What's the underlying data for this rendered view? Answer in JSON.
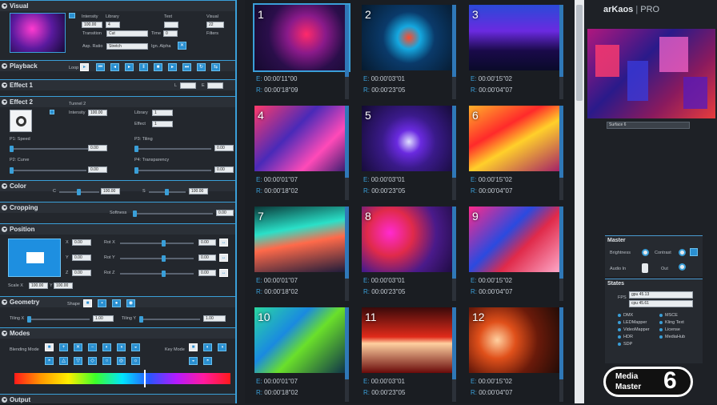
{
  "panel": {
    "visual": {
      "title": "Visual",
      "intensity_label": "Intensity",
      "intensity_value": "100.00",
      "library_label": "Library",
      "library_value": "4",
      "transition_label": "Transition",
      "transition_value": "Cut",
      "time_label": "Time",
      "time_value": "0",
      "aspect_label": "Asp. Ratio",
      "aspect_value": "Stretch",
      "ign_alpha_label": "Ign. Alpha",
      "text_label": "Text",
      "visual_label": "Visual",
      "visual_value": "22",
      "filters_label": "Filters"
    },
    "playback": {
      "title": "Playback",
      "loop_label": "Loop"
    },
    "effect1": {
      "title": "Effect 1",
      "l_label": "L",
      "e_label": "E"
    },
    "effect2": {
      "title": "Effect 2",
      "tunnel_label": "Tunnel 2",
      "intensity_label": "Intensity",
      "intensity_value": "100.00",
      "library_label": "Library",
      "library_value": "1",
      "effect_label": "Effect",
      "effect_value": "1",
      "p1": "P1: Speed",
      "p2": "P2: Curve",
      "p3": "P3: Tiling",
      "p4": "P4: Transparency",
      "v": "0.00"
    },
    "color": {
      "title": "Color",
      "c_label": "C",
      "c_value": "100.00",
      "s_label": "S",
      "s_value": "100.00"
    },
    "cropping": {
      "title": "Cropping",
      "softness_label": "Softness",
      "softness_value": "0.00"
    },
    "position": {
      "title": "Position",
      "x": "X",
      "y": "Y",
      "z": "Z",
      "rotx": "Rot X",
      "roty": "Rot Y",
      "rotz": "Rot Z",
      "v": "0.00",
      "scale_x_label": "Scale X",
      "scale_x": "100.00",
      "scale_y_label": "Y",
      "scale_y": "100.00"
    },
    "geometry": {
      "title": "Geometry",
      "shape_label": "Shape",
      "tiling_x_label": "Tiling X",
      "tiling_x": "1.00",
      "tiling_y_label": "Tiling Y",
      "tiling_y": "1.00"
    },
    "modes": {
      "title": "Modes",
      "blending_label": "Blending Mode",
      "key_label": "Key Mode"
    },
    "output": {
      "title": "Output"
    }
  },
  "clips": [
    {
      "n": "1",
      "e": "00:00'11\"00",
      "r": "00:00'18\"09"
    },
    {
      "n": "2",
      "e": "00:00'03\"01",
      "r": "00:00'23\"05"
    },
    {
      "n": "3",
      "e": "00:00'15\"02",
      "r": "00:00'04\"07"
    },
    {
      "n": "4",
      "e": "00:00'01\"07",
      "r": "00:00'18\"02"
    },
    {
      "n": "5",
      "e": "00:00'03\"01",
      "r": "00:00'23\"05"
    },
    {
      "n": "6",
      "e": "00:00'15\"02",
      "r": "00:00'04\"07"
    },
    {
      "n": "7",
      "e": "00:00'01\"07",
      "r": "00:00'18\"02"
    },
    {
      "n": "8",
      "e": "00:00'03\"01",
      "r": "00:00'23\"05"
    },
    {
      "n": "9",
      "e": "00:00'15\"02",
      "r": "00:00'04\"07"
    },
    {
      "n": "10",
      "e": "00:00'01\"07",
      "r": "00:00'18\"02"
    },
    {
      "n": "11",
      "e": "00:00'03\"01",
      "r": "00:00'23\"05"
    },
    {
      "n": "12",
      "e": "00:00'15\"02",
      "r": "00:00'04\"07"
    }
  ],
  "clip_prefix": {
    "e": "E:",
    "r": "R:"
  },
  "right": {
    "brand": "arKaos",
    "brand_pro": "PRO",
    "surface": "Surface 6",
    "master": {
      "title": "Master",
      "brightness": "Brightness",
      "contrast": "Contrast",
      "audio": "Audio In",
      "out": "Out"
    },
    "states": {
      "title": "States",
      "fps_label": "FPS",
      "fps1": "gpu 45.13",
      "fps2": "cpu 45.61",
      "items": [
        "DMX",
        "MSCE",
        "LEDMapper",
        "Kling Text",
        "VideoMapper",
        "License",
        "HDR",
        "MediaHub",
        "SDP"
      ]
    },
    "logo_top": "Media",
    "logo_bottom": "Master",
    "logo_num": "6"
  }
}
